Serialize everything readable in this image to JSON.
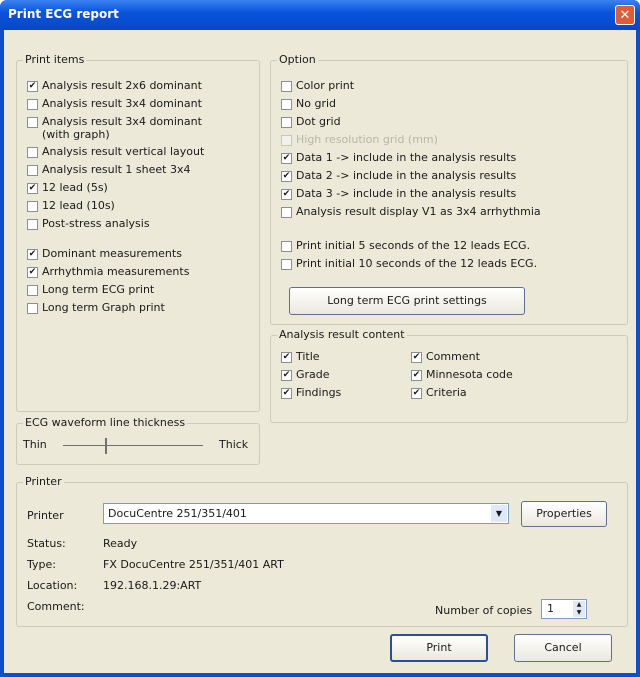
{
  "window": {
    "title": "Print ECG report",
    "close_glyph": "✕"
  },
  "print_items": {
    "legend": "Print items",
    "items": [
      {
        "label": "Analysis result 2x6 dominant",
        "checked": true
      },
      {
        "label": "Analysis result 3x4 dominant",
        "checked": false
      },
      {
        "label": "Analysis result 3x4 dominant",
        "label2": "(with graph)",
        "checked": false
      },
      {
        "label": "Analysis result vertical layout",
        "checked": false
      },
      {
        "label": "Analysis result 1 sheet 3x4",
        "checked": false
      },
      {
        "label": "12 lead (5s)",
        "checked": true
      },
      {
        "label": "12 lead (10s)",
        "checked": false
      },
      {
        "label": "Post-stress analysis",
        "checked": false
      },
      {
        "label": "Dominant measurements",
        "checked": true
      },
      {
        "label": "Arrhythmia measurements",
        "checked": true
      },
      {
        "label": "Long term ECG print",
        "checked": false
      },
      {
        "label": "Long term Graph print",
        "checked": false
      }
    ]
  },
  "option": {
    "legend": "Option",
    "items": [
      {
        "label": "Color print",
        "checked": false,
        "disabled": false
      },
      {
        "label": "No grid",
        "checked": false,
        "disabled": false
      },
      {
        "label": "Dot grid",
        "checked": false,
        "disabled": false
      },
      {
        "label": "High resolution grid (mm)",
        "checked": false,
        "disabled": true
      },
      {
        "label": "Data 1 -> include in the analysis results",
        "checked": true,
        "disabled": false
      },
      {
        "label": "Data 2 -> include in the analysis results",
        "checked": true,
        "disabled": false
      },
      {
        "label": "Data 3 -> include in the analysis results",
        "checked": true,
        "disabled": false
      },
      {
        "label": "Analysis result display V1 as 3x4 arrhythmia",
        "checked": false,
        "disabled": false
      },
      {
        "label": "Print initial 5 seconds of the 12 leads ECG.",
        "checked": false,
        "disabled": false
      },
      {
        "label": "Print initial 10 seconds of the 12 leads ECG.",
        "checked": false,
        "disabled": false
      }
    ],
    "settings_button": "Long term ECG print settings"
  },
  "analysis_content": {
    "legend": "Analysis result content",
    "items": [
      {
        "label": "Title",
        "checked": true
      },
      {
        "label": "Grade",
        "checked": true
      },
      {
        "label": "Findings",
        "checked": true
      },
      {
        "label": "Comment",
        "checked": true
      },
      {
        "label": "Minnesota code",
        "checked": true
      },
      {
        "label": "Criteria",
        "checked": true
      }
    ]
  },
  "thickness": {
    "legend": "ECG waveform line thickness",
    "min_label": "Thin",
    "max_label": "Thick",
    "level": 0.3
  },
  "printer": {
    "legend": "Printer",
    "printer_label": "Printer",
    "printer_value": "DocuCentre 251/351/401",
    "dropdown_arrow": "▼",
    "properties_button": "Properties",
    "status_label": "Status:",
    "status_value": "Ready",
    "type_label": "Type:",
    "type_value": "FX DocuCentre 251/351/401 ART",
    "location_label": "Location:",
    "location_value": "192.168.1.29:ART",
    "comment_label": "Comment:",
    "copies_label": "Number of copies",
    "copies_value": "1"
  },
  "buttons": {
    "print": "Print",
    "cancel": "Cancel"
  },
  "check_glyph": "✔"
}
